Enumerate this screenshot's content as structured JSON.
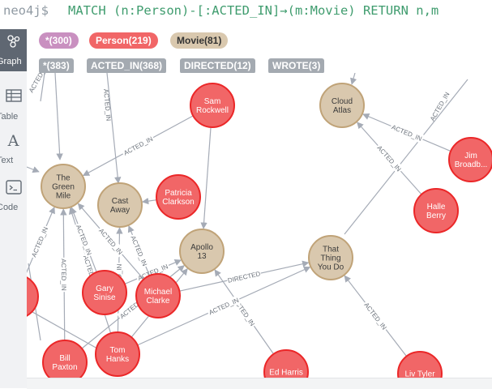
{
  "editor": {
    "prompt": "neo4j$",
    "query": "MATCH (n:Person)-[:ACTED_IN]→(m:Movie) RETURN n,m"
  },
  "sidebar": {
    "items": [
      {
        "label": "Graph",
        "icon": "graph-icon",
        "active": true
      },
      {
        "label": "Table",
        "icon": "table-icon",
        "active": false
      },
      {
        "label": "Text",
        "icon": "text-icon",
        "active": false
      },
      {
        "label": "Code",
        "icon": "code-icon",
        "active": false
      }
    ]
  },
  "node_labels": [
    {
      "label": "*(300)",
      "color": "#c990c0"
    },
    {
      "label": "Person(219)",
      "color": "#f16667"
    },
    {
      "label": "Movie(81)",
      "color": "#d9c8ae"
    }
  ],
  "relationship_types": [
    {
      "label": "*(383)"
    },
    {
      "label": "ACTED_IN(368)"
    },
    {
      "label": "DIRECTED(12)"
    },
    {
      "label": "WROTE(3)"
    }
  ],
  "colors": {
    "person_fill": "#f16667",
    "person_border": "#eb2728",
    "movie_fill": "#d9c8ae",
    "movie_border": "#c0a378",
    "edge": "#a5abb6"
  },
  "graph": {
    "nodes": [
      {
        "id": "sam",
        "type": "person",
        "lines": [
          "Sam",
          "Rockwell"
        ]
      },
      {
        "id": "cloud",
        "type": "movie",
        "lines": [
          "Cloud",
          "Atlas"
        ]
      },
      {
        "id": "jim",
        "type": "person",
        "lines": [
          "Jim",
          "Broadb..."
        ]
      },
      {
        "id": "green",
        "type": "movie",
        "lines": [
          "The",
          "Green",
          "Mile"
        ]
      },
      {
        "id": "cast",
        "type": "movie",
        "lines": [
          "Cast",
          "Away"
        ]
      },
      {
        "id": "patricia",
        "type": "person",
        "lines": [
          "Patricia",
          "Clarkson"
        ]
      },
      {
        "id": "halle",
        "type": "person",
        "lines": [
          "Halle",
          "Berry"
        ]
      },
      {
        "id": "apollo",
        "type": "movie",
        "lines": [
          "Apollo",
          "13"
        ]
      },
      {
        "id": "thing",
        "type": "movie",
        "lines": [
          "That",
          "Thing",
          "You Do"
        ]
      },
      {
        "id": "gary",
        "type": "person",
        "lines": [
          "Gary",
          "Sinise"
        ]
      },
      {
        "id": "michael",
        "type": "person",
        "lines": [
          "Michael",
          "Clarke"
        ]
      },
      {
        "id": "tom",
        "type": "person",
        "lines": [
          "Tom",
          "Hanks"
        ]
      },
      {
        "id": "bill",
        "type": "person",
        "lines": [
          "Bill",
          "Paxton"
        ]
      },
      {
        "id": "ed",
        "type": "person",
        "lines": [
          "Ed Harris"
        ]
      },
      {
        "id": "liv",
        "type": "person",
        "lines": [
          "Liv Tyler"
        ]
      },
      {
        "id": "left",
        "type": "person",
        "lines": []
      }
    ],
    "edges": [
      {
        "from": "sam",
        "to": "green",
        "label": "ACTED_IN"
      },
      {
        "from": "sam",
        "to": "apollo",
        "label": ""
      },
      {
        "from": "jim",
        "to": "cloud",
        "label": "ACTED_IN"
      },
      {
        "from": "halle",
        "to": "cloud",
        "label": "ACTED_IN"
      },
      {
        "from": "patricia",
        "to": "cast",
        "label": ""
      },
      {
        "from": "liv",
        "to": "thing",
        "label": "ACTED_IN"
      },
      {
        "from": "ed",
        "to": "apollo",
        "label": "ACTED_IN"
      },
      {
        "from": "tom",
        "to": "thing",
        "label": "ACTED_IN"
      },
      {
        "from": "tom",
        "to": "green",
        "label": "ACTED_IN"
      },
      {
        "from": "tom",
        "to": "cast",
        "label": "ACTED_IN"
      },
      {
        "from": "tom",
        "to": "apollo",
        "label": "ACTED_IN"
      },
      {
        "from": "gary",
        "to": "green",
        "label": "ACTED_IN"
      },
      {
        "from": "gary",
        "to": "apollo",
        "label": "ACTED_IN"
      },
      {
        "from": "bill",
        "to": "green",
        "label": "ACTED_IN"
      },
      {
        "from": "bill",
        "to": "apollo",
        "label": "ACTED_IN"
      },
      {
        "from": "michael",
        "to": "thing",
        "label": "DIRECTED"
      },
      {
        "from": "michael",
        "to": "green",
        "label": "ACTED_IN"
      },
      {
        "from": "michael",
        "to": "cast",
        "label": "ACTED_IN"
      },
      {
        "from": "left",
        "to": "green",
        "label": "ACTED_IN"
      }
    ]
  }
}
